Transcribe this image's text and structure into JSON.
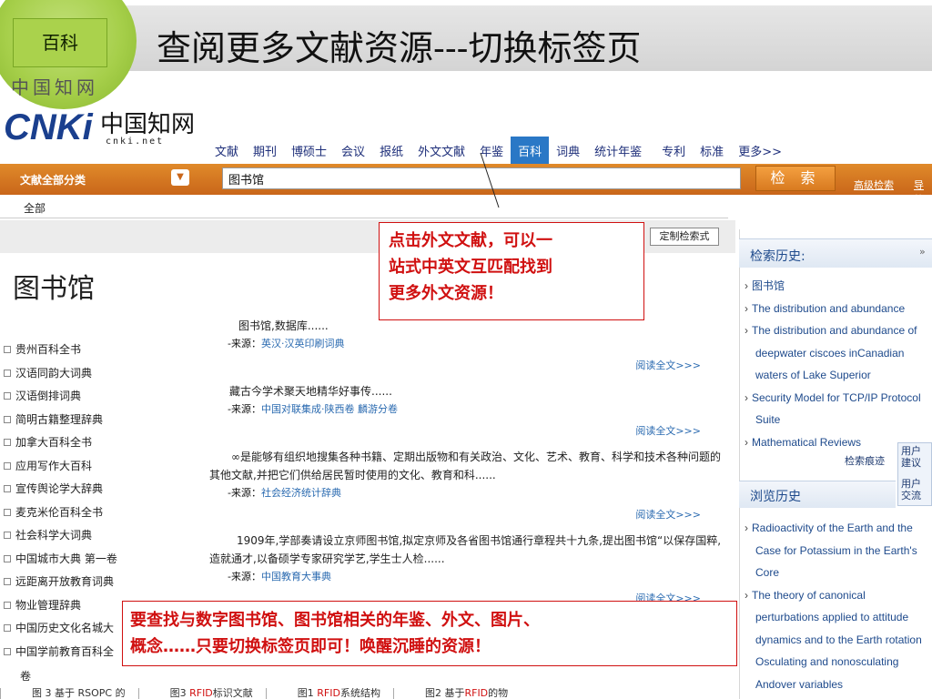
{
  "slide": {
    "badge": "百科",
    "title": "查阅更多文献资源---切换标签页",
    "logo_ghost": "中国知网"
  },
  "logo": {
    "mark": "CNKi",
    "cn": "中国知网",
    "url": "cnki.net"
  },
  "nav": {
    "tabs": [
      {
        "label": "文献"
      },
      {
        "label": "期刊"
      },
      {
        "label": "博硕士"
      },
      {
        "label": "会议"
      },
      {
        "label": "报纸"
      },
      {
        "label": "外文文献"
      },
      {
        "label": "年鉴"
      },
      {
        "label": "百科",
        "active": true
      },
      {
        "label": "词典"
      },
      {
        "label": "统计年鉴"
      },
      {
        "label": "专利"
      },
      {
        "label": "标准"
      },
      {
        "label": "更多>>"
      }
    ]
  },
  "search": {
    "category": "文献全部分类",
    "query": "图书馆",
    "button": "检 索",
    "advanced": "高级检索",
    "guide": "导航"
  },
  "breadcrumb": "全部",
  "custom_format": "定制检索式",
  "entry_title": "图书馆",
  "library_list": [
    "贵州百科全书",
    "汉语同韵大词典",
    "汉语倒排词典",
    "简明古籍整理辞典",
    "加拿大百科全书",
    "应用写作大百科",
    "宣传舆论学大辞典",
    "麦克米伦百科全书",
    "社会科学大词典",
    "中国城市大典 第一卷",
    "远距离开放教育词典",
    "物业管理辞典",
    "中国历史文化名城大",
    "中国学前教育百科全"
  ],
  "library_list_tail": "卷",
  "results": [
    {
      "text": "图书馆,数据库......",
      "source_label": "-来源：",
      "source": "英汉·汉英印刷词典",
      "more": "阅读全文>>>"
    },
    {
      "text": "藏古今学术聚天地精华好事传......",
      "source_label": "-来源：",
      "source": "中国对联集成·陕西卷 麟游分卷",
      "more": "阅读全文>>>"
    },
    {
      "text": "∞是能够有组织地搜集各种书籍、定期出版物和有关政治、文化、艺术、教育、科学和技术各种问题的其他文献,并把它们供给居民暂时使用的文化、教育和科......",
      "source_label": "-来源：",
      "source": "社会经济统计辞典",
      "more": "阅读全文>>>"
    },
    {
      "text": "1909年,学部奏请设立京师图书馆,拟定京师及各省图书馆通行章程共十九条,提出图书馆“以保存国粹,造就通才,以备硕学专家研究学艺,学生士人检......",
      "source_label": "-来源：",
      "source": "中国教育大事典",
      "more": "阅读全文>>>"
    }
  ],
  "right_panel": {
    "search_history_title": "检索历史:",
    "toggle": "»",
    "search_history": [
      {
        "text": "图书馆",
        "arrow": true
      },
      {
        "text": "The distribution and abundance",
        "arrow": true
      },
      {
        "text": "The distribution and abundance of",
        "arrow": true
      },
      {
        "text": "deepwater ciscoes inCanadian",
        "arrow": false
      },
      {
        "text": "waters of Lake Superior",
        "arrow": false
      },
      {
        "text": "Security Model for TCP/IP Protocol",
        "arrow": true
      },
      {
        "text": "Suite",
        "arrow": false
      },
      {
        "text": "Mathematical Reviews",
        "arrow": true
      }
    ],
    "trail": "检索痕迹",
    "feedback": [
      "用户",
      "建议",
      "用户",
      "交流"
    ],
    "browse_history_title": "浏览历史",
    "browse_history": [
      {
        "text": "Radioactivity of the Earth and the",
        "arrow": true
      },
      {
        "text": "Case for Potassium in the Earth's",
        "arrow": false
      },
      {
        "text": "Core",
        "arrow": false
      },
      {
        "text": "The theory of canonical",
        "arrow": true
      },
      {
        "text": "perturbations applied to attitude",
        "arrow": false
      },
      {
        "text": "dynamics and to the Earth rotation",
        "arrow": false
      },
      {
        "text": "Osculating and nonosculating",
        "arrow": false
      },
      {
        "text": "Andover variables",
        "arrow": false
      }
    ]
  },
  "callouts": {
    "c1_line1": "点击外文文献，可以一",
    "c1_line2": "站式中英文互匹配找到",
    "c1_line3": "更多外文资源！",
    "c2_line1": "要查找与数字图书馆、图书馆相关的年鉴、外文、图片、",
    "c2_line2": "概念……只要切换标签页即可！唤醒沉睡的资源！"
  },
  "bottom_tabs": [
    {
      "pre": "图 3 基于 RSOPC 的",
      "red": "",
      "post": ""
    },
    {
      "pre": "图3 ",
      "red": "RFID",
      "post": "标识文献"
    },
    {
      "pre": "图1 ",
      "red": "RFID",
      "post": "系统结构"
    },
    {
      "pre": "图2 基于",
      "red": "RFID",
      "post": "的物"
    }
  ],
  "colors": {
    "accent_orange": "#d87a20",
    "active_tab": "#2a78c6",
    "callout_red": "#d01010",
    "slide_green": "#aad24c"
  }
}
